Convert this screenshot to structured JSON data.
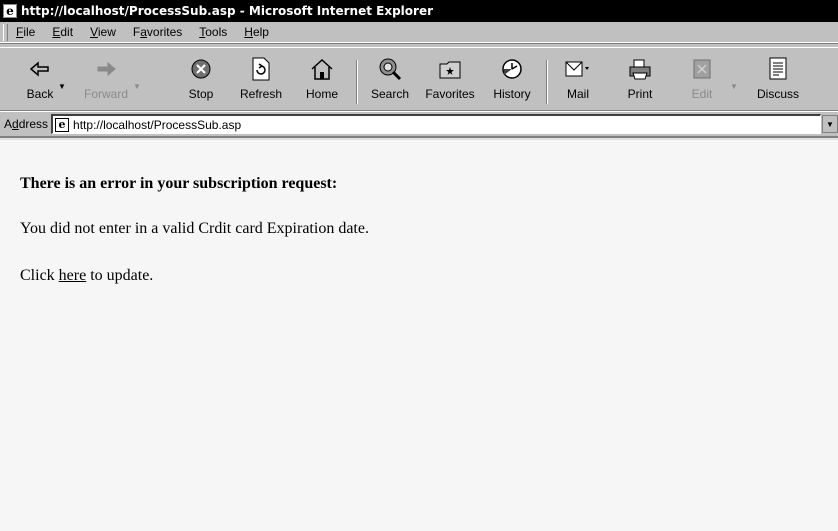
{
  "window": {
    "title": "http://localhost/ProcessSub.asp - Microsoft Internet Explorer"
  },
  "menu": {
    "items": [
      {
        "pre": "",
        "key": "F",
        "post": "ile"
      },
      {
        "pre": "",
        "key": "E",
        "post": "dit"
      },
      {
        "pre": "",
        "key": "V",
        "post": "iew"
      },
      {
        "pre": "F",
        "key": "a",
        "post": "vorites"
      },
      {
        "pre": "",
        "key": "T",
        "post": "ools"
      },
      {
        "pre": "",
        "key": "H",
        "post": "elp"
      }
    ]
  },
  "toolbar": {
    "back": "Back",
    "forward": "Forward",
    "stop": "Stop",
    "refresh": "Refresh",
    "home": "Home",
    "search": "Search",
    "favorites": "Favorites",
    "history": "History",
    "mail": "Mail",
    "print": "Print",
    "edit": "Edit",
    "discuss": "Discuss"
  },
  "address": {
    "label_pre": "A",
    "label_key": "d",
    "label_post": "dress",
    "url": "http://localhost/ProcessSub.asp"
  },
  "page": {
    "heading": "There is an error in your subscription request:",
    "message": "You did not enter in a valid Crdit card Expiration date.",
    "click_pre": "Click ",
    "link": "here",
    "click_post": " to update."
  }
}
